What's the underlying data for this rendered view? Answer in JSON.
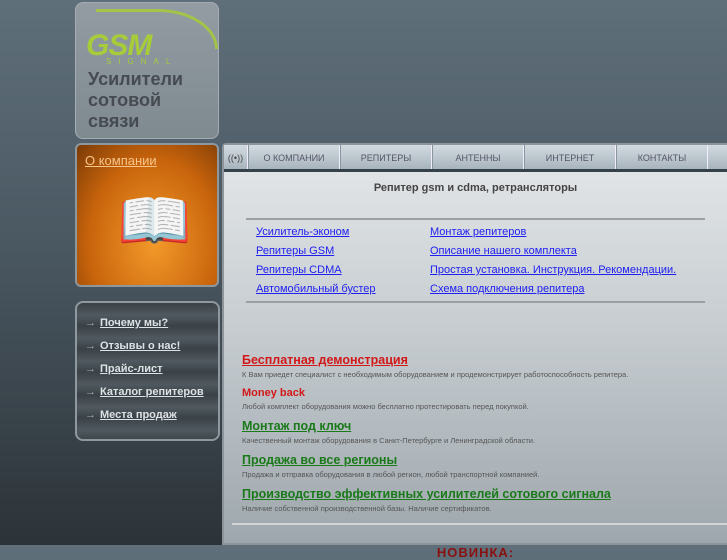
{
  "logo": {
    "brand": "GSM",
    "sub": "SIGNAL",
    "tagline": [
      "Усилители",
      "сотовой",
      "связи"
    ]
  },
  "promo": {
    "label": "О компании"
  },
  "side_menu": [
    "Почему мы?",
    "Отзывы о нас!",
    "Прайс-лист",
    "Каталог репитеров",
    "Места продаж"
  ],
  "nav": {
    "icon": "((•))",
    "tabs": [
      "О КОМПАНИИ",
      "РЕПИТЕРЫ",
      "АНТЕННЫ",
      "ИНТЕРНЕТ",
      "КОНТАКТЫ"
    ]
  },
  "page_title": "Репитер gsm и cdma, ретрансляторы",
  "links": [
    "Усилитель-эконом",
    "Монтаж репитеров",
    "Репитеры GSM",
    "Описание нашего комплекта",
    "Репитеры CDMA",
    "Простая установка. Инструкция. Рекомендации.",
    "Автомобильный бустер",
    "Схема подключения репитера"
  ],
  "features": [
    {
      "title": "Бесплатная демонстрация",
      "text": "К Вам приедет специалист с необходимым оборудованием и продемонстрирует работоспособность репитера."
    },
    {
      "title": "Money back",
      "text": "Любой комплект оборудования можно бесплатно протестировать перед покупкой."
    },
    {
      "title": "Монтаж под ключ",
      "text": "Качественный монтаж оборудования в Санкт-Петербурге и Ленинградской области."
    },
    {
      "title": "Продажа во все регионы",
      "text": "Продажа и отправка оборудования в любой регион, любой транспортной компанией."
    },
    {
      "title": "Производство эффективных усилителей сотового сигнала",
      "text": "Наличие собственной производственной базы. Наличие сертификатов."
    }
  ],
  "new_label": "НОВИНКА:"
}
